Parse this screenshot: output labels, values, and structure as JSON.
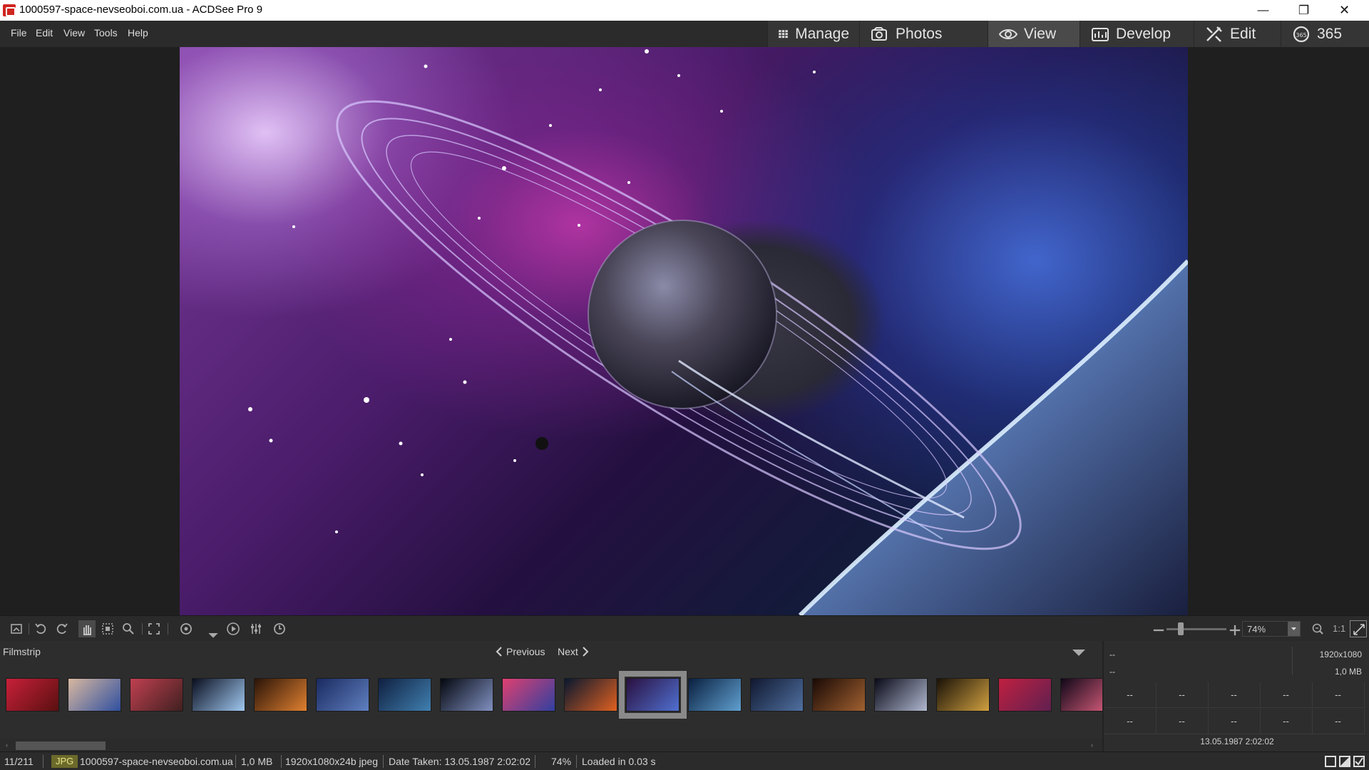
{
  "window": {
    "title": "1000597-space-nevseoboi.com.ua - ACDSee Pro 9",
    "minimize": "—",
    "maximize": "❐",
    "close": "✕"
  },
  "menu": [
    "File",
    "Edit",
    "View",
    "Tools",
    "Help"
  ],
  "modes": [
    {
      "label": "Manage",
      "icon": "grid-icon",
      "active": false
    },
    {
      "label": "Photos",
      "icon": "photos-icon",
      "active": false
    },
    {
      "label": "View",
      "icon": "eye-icon",
      "active": true
    },
    {
      "label": "Develop",
      "icon": "develop-icon",
      "active": false
    },
    {
      "label": "Edit",
      "icon": "edit-icon",
      "active": false
    },
    {
      "label": "365",
      "icon": "acdsee-365-icon",
      "active": false
    }
  ],
  "toolbar": {
    "zoom_value": "74%",
    "one_to_one": "1:1"
  },
  "filmstrip": {
    "label": "Filmstrip",
    "previous": "Previous",
    "next": "Next",
    "thumbnails": [
      {
        "name": "red-planet",
        "colors": [
          "#c8203a",
          "#5a1010"
        ]
      },
      {
        "name": "cratered-moon",
        "colors": [
          "#d8b8a0",
          "#3050a0"
        ]
      },
      {
        "name": "mars-red-sky",
        "colors": [
          "#c04050",
          "#402020"
        ]
      },
      {
        "name": "earth-horizon-dark",
        "colors": [
          "#0a0f20",
          "#a0c8f0"
        ]
      },
      {
        "name": "orange-horizon",
        "colors": [
          "#2a1408",
          "#e08030"
        ]
      },
      {
        "name": "blue-nebula-ground",
        "colors": [
          "#1a2a60",
          "#6080c0"
        ]
      },
      {
        "name": "earth-blue",
        "colors": [
          "#102040",
          "#4080b0"
        ]
      },
      {
        "name": "planet-crescent",
        "colors": [
          "#050810",
          "#8090c0"
        ]
      },
      {
        "name": "galaxy-pink",
        "colors": [
          "#e04070",
          "#3040a0"
        ]
      },
      {
        "name": "helix-eye",
        "colors": [
          "#081830",
          "#e06020"
        ]
      },
      {
        "name": "current-saturn",
        "colors": [
          "#2a1040",
          "#5070d0"
        ]
      },
      {
        "name": "earth-sunrise",
        "colors": [
          "#0a2040",
          "#60a0d0"
        ]
      },
      {
        "name": "ringed-planet-blue",
        "colors": [
          "#101830",
          "#5070a0"
        ]
      },
      {
        "name": "planets-orange",
        "colors": [
          "#1a0a06",
          "#a06030"
        ]
      },
      {
        "name": "moon-surface",
        "colors": [
          "#0a0a18",
          "#b0b8d0"
        ]
      },
      {
        "name": "galaxy-yellow",
        "colors": [
          "#1a1208",
          "#d0a040"
        ]
      },
      {
        "name": "red-nebula",
        "colors": [
          "#c02040",
          "#602050"
        ]
      },
      {
        "name": "star-burst",
        "colors": [
          "#100818",
          "#e06080"
        ]
      }
    ]
  },
  "info": {
    "top_left_1": "--",
    "top_left_2": "--",
    "dimensions": "1920x1080",
    "size": "1,0 MB",
    "grid": [
      "--",
      "--",
      "--",
      "--",
      "--",
      "--",
      "--",
      "--",
      "--",
      "--"
    ],
    "date": "13.05.1987 2:02:02"
  },
  "status": {
    "position": "11/211",
    "type": "JPG",
    "filename": "1000597-space-nevseoboi.com.ua",
    "filesize": "1,0 MB",
    "dims": "1920x1080x24b jpeg",
    "date_taken": "Date Taken: 13.05.1987 2:02:02",
    "zoom": "74%",
    "loaded": "Loaded in 0.03 s"
  }
}
